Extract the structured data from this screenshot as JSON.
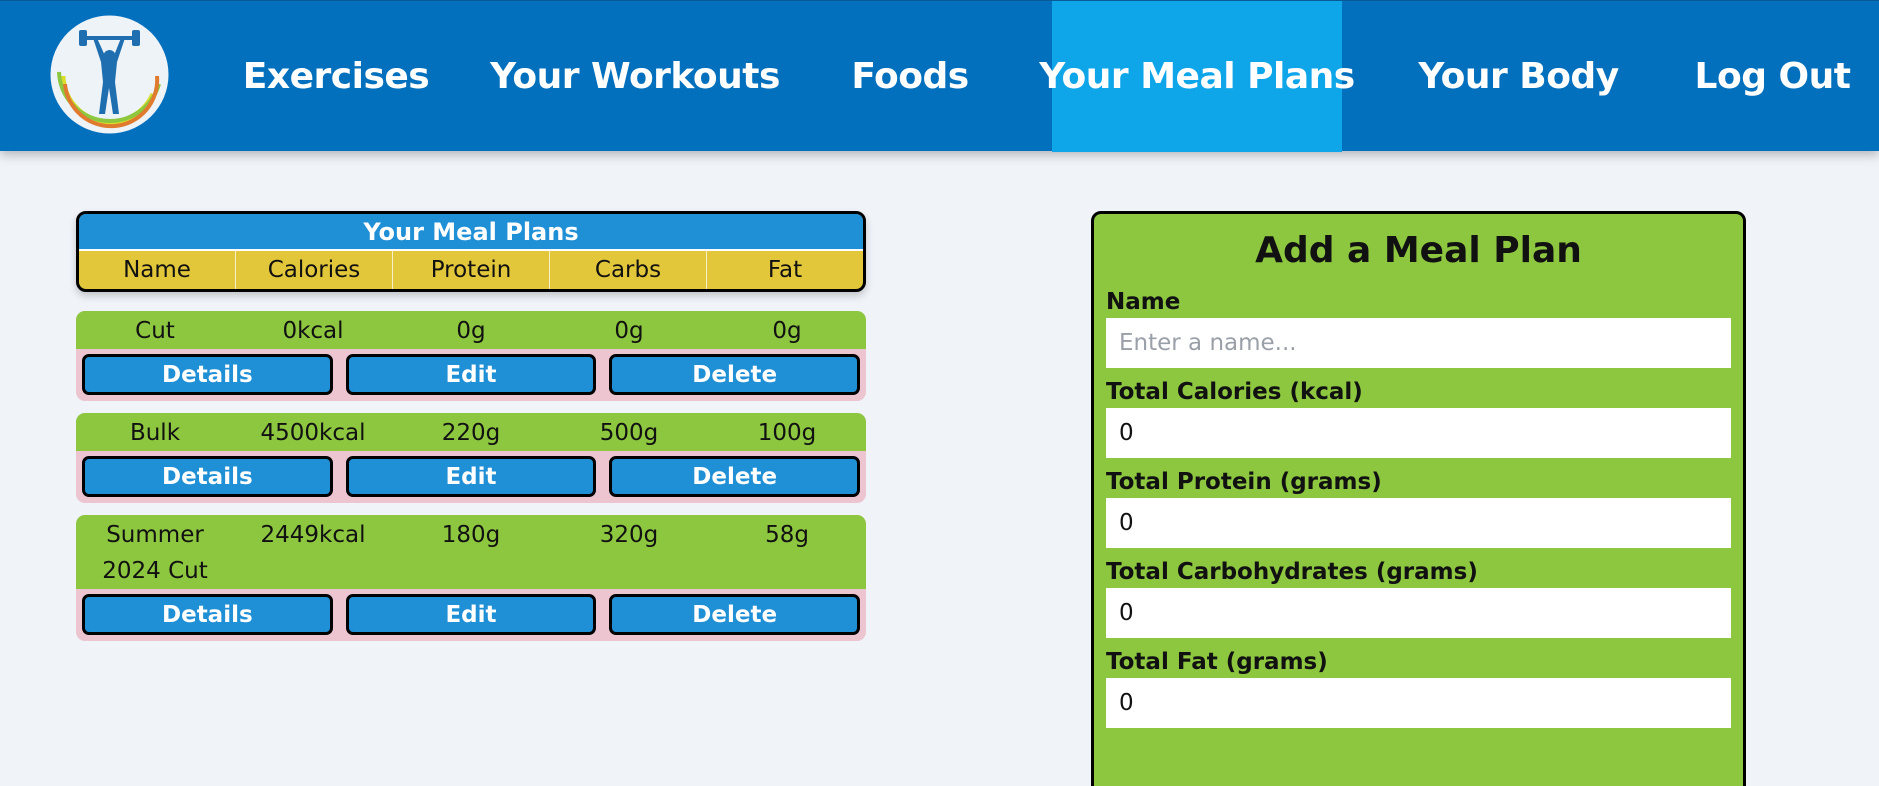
{
  "nav": {
    "items": [
      {
        "label": "Exercises"
      },
      {
        "label": "Your Workouts"
      },
      {
        "label": "Foods"
      },
      {
        "label": "Your Meal Plans"
      },
      {
        "label": "Your Body"
      },
      {
        "label": "Log Out"
      }
    ],
    "active_item": "Your Meal Plans",
    "logo_icon": "weightlifter-logo-icon"
  },
  "meal_plans": {
    "title": "Your Meal Plans",
    "columns": [
      "Name",
      "Calories",
      "Protein",
      "Carbs",
      "Fat"
    ],
    "rows": [
      {
        "name": "Cut",
        "calories": "0kcal",
        "protein": "0g",
        "carbs": "0g",
        "fat": "0g"
      },
      {
        "name": "Bulk",
        "calories": "4500kcal",
        "protein": "220g",
        "carbs": "500g",
        "fat": "100g"
      },
      {
        "name": "Summer 2024 Cut",
        "calories": "2449kcal",
        "protein": "180g",
        "carbs": "320g",
        "fat": "58g"
      }
    ],
    "buttons": {
      "details": "Details",
      "edit": "Edit",
      "delete": "Delete"
    }
  },
  "add_form": {
    "title": "Add a Meal Plan",
    "fields": [
      {
        "label": "Name",
        "value": "",
        "placeholder": "Enter a name..."
      },
      {
        "label": "Total Calories (kcal)",
        "value": "0",
        "placeholder": ""
      },
      {
        "label": "Total Protein (grams)",
        "value": "0",
        "placeholder": ""
      },
      {
        "label": "Total Carbohydrates (grams)",
        "value": "0",
        "placeholder": ""
      },
      {
        "label": "Total Fat (grams)",
        "value": "0",
        "placeholder": ""
      }
    ]
  },
  "colors": {
    "nav_bg": "#0370bd",
    "nav_active": "#0ea5e9",
    "header_blue": "#1f8fd6",
    "header_yellow": "#e3c73a",
    "row_green": "#8dc63f",
    "row_pink": "#ecc5d1",
    "page_bg": "#f0f4f9"
  }
}
